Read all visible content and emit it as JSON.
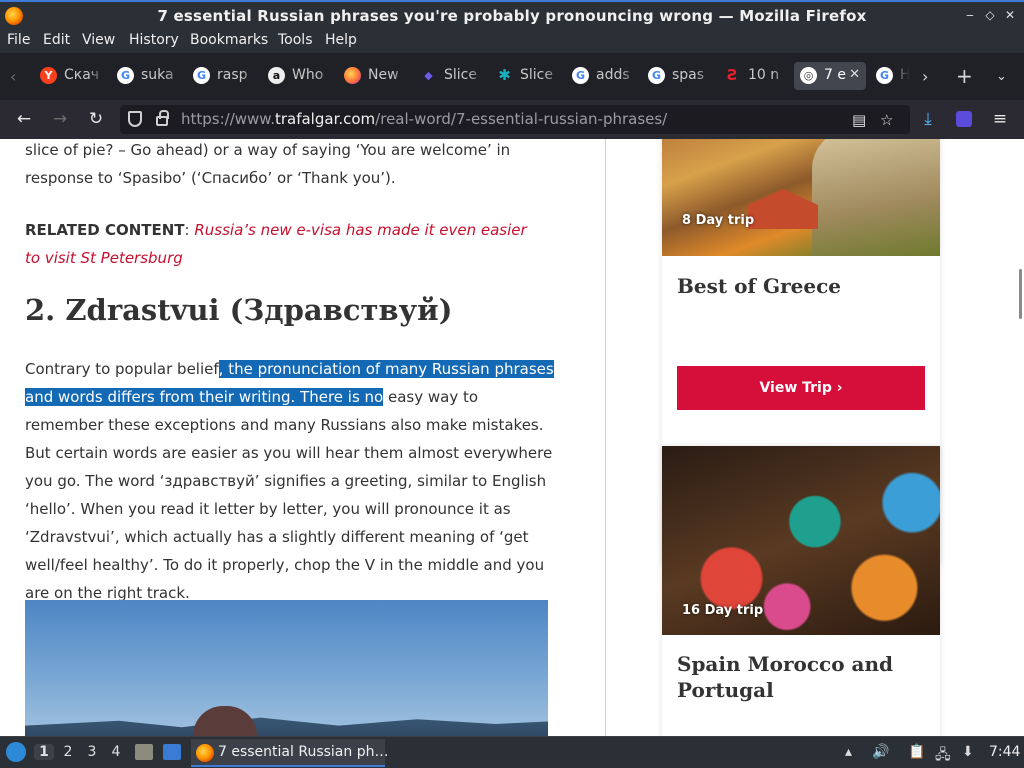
{
  "window": {
    "title": "7 essential Russian phrases you're probably pronouncing wrong — Mozilla Firefox",
    "controls": {
      "minimize": "‒",
      "maximize": "◇",
      "close": "✕"
    }
  },
  "menu": [
    "File",
    "Edit",
    "View",
    "History",
    "Bookmarks",
    "Tools",
    "Help"
  ],
  "tabs": [
    {
      "label": "Скач",
      "icon": "Y",
      "icon_color": "#fc3f1d"
    },
    {
      "label": "suka",
      "icon": "G",
      "icon_color": "#ffffff"
    },
    {
      "label": "rasp",
      "icon": "G",
      "icon_color": "#ffffff"
    },
    {
      "label": "Who",
      "icon": "a",
      "icon_color": "#111111"
    },
    {
      "label": "New",
      "icon": "●",
      "icon_color": "#ff7139"
    },
    {
      "label": "Slice",
      "icon": "◆",
      "icon_color": "#6d5ce7"
    },
    {
      "label": "Slice",
      "icon": "✱",
      "icon_color": "#19b2bd"
    },
    {
      "label": "adds",
      "icon": "G",
      "icon_color": "#ffffff"
    },
    {
      "label": "spas",
      "icon": "G",
      "icon_color": "#ffffff"
    },
    {
      "label": "10 n",
      "icon": "Ƨ",
      "icon_color": "#e8202a"
    },
    {
      "label": "7 e",
      "icon": "◎",
      "icon_color": "#ffffff",
      "active": true
    },
    {
      "label": "He",
      "icon": "G",
      "icon_color": "#ffffff"
    }
  ],
  "nav": {
    "url_prefix": "https://www.",
    "url_domain": "trafalgar.com",
    "url_path": "/real-word/7-essential-russian-phrases/"
  },
  "article": {
    "p1": "slice of pie? – Go ahead) or a way of saying ‘You are welcome’ in response to ‘Spasibo’ (‘Спасибо’ or ‘Thank you’).",
    "related_label": "RELATED CONTENT",
    "related_sep": ": ",
    "related_link": "Russia’s new e-visa has made it even easier to visit St Petersburg",
    "heading": "2. Zdrastvui (Здравствуй)",
    "p2_before": "Contrary to popular belief",
    "p2_highlight": ", the pronunciation of many Russian phrases and words differs from their writing. There is no",
    "p2_after": " easy way to remember these exceptions and many Russians also make mistakes. But certain words are easier as you will hear them almost everywhere you go. The word ‘здравствуй’ signifies a greeting, similar to English ‘hello’. When you read it letter by letter, you will pronounce it as ‘Zdravstvui’, which actually has a slightly different meaning of ‘get well/feel healthy’. To do it properly, chop the V in the middle and you are on the right track."
  },
  "sidebar": {
    "cards": [
      {
        "badge": "8 Day trip",
        "title": "Best of Greece",
        "button": "View Trip ›"
      },
      {
        "badge": "16 Day trip",
        "title": "Spain Morocco and Portugal"
      }
    ]
  },
  "taskbar": {
    "workspaces": [
      "1",
      "2",
      "3",
      "4"
    ],
    "task_label": "7 essential Russian ph…",
    "clock": "7:44"
  }
}
